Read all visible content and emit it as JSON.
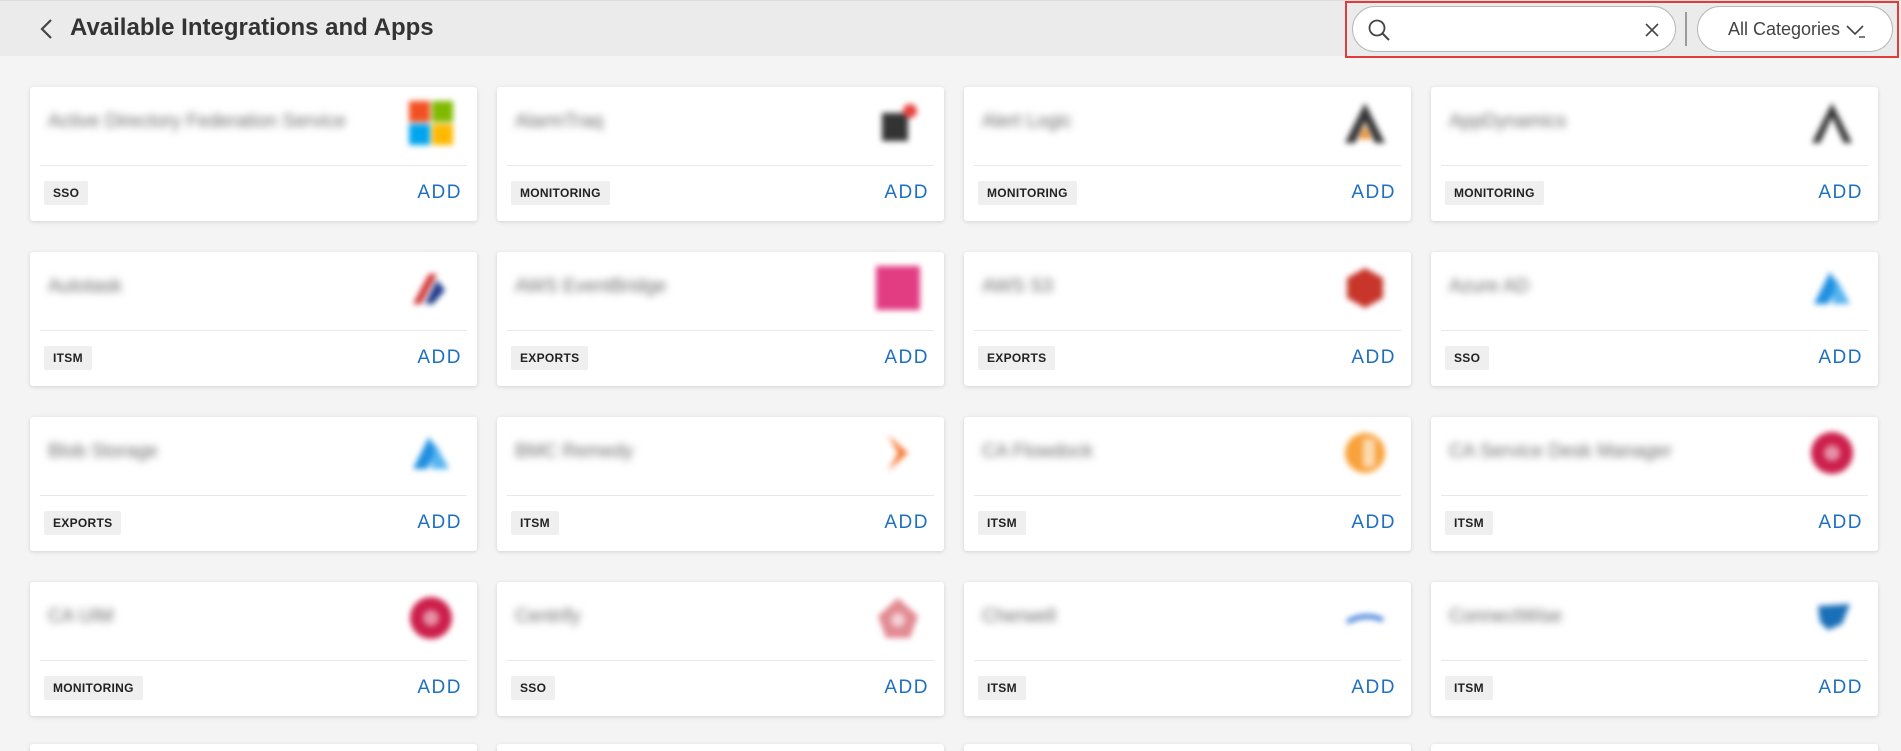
{
  "header": {
    "title": "Available Integrations and Apps",
    "search_value": "",
    "category_label": "All Categories"
  },
  "colors": {
    "accent": "#1d6fc1",
    "highlight": "#e03c3c"
  },
  "cards": [
    {
      "name": "Active Directory Federation Service",
      "tag": "SSO",
      "action": "ADD",
      "logo": "microsoft-logo-icon"
    },
    {
      "name": "AlarmTraq",
      "tag": "MONITORING",
      "action": "ADD",
      "logo": "alarm-logo-icon"
    },
    {
      "name": "Alert Logic",
      "tag": "MONITORING",
      "action": "ADD",
      "logo": "alertlogic-logo-icon"
    },
    {
      "name": "AppDynamics",
      "tag": "MONITORING",
      "action": "ADD",
      "logo": "appdynamics-logo-icon"
    },
    {
      "name": "Autotask",
      "tag": "ITSM",
      "action": "ADD",
      "logo": "autotask-logo-icon"
    },
    {
      "name": "AWS EventBridge",
      "tag": "EXPORTS",
      "action": "ADD",
      "logo": "eventbridge-logo-icon"
    },
    {
      "name": "AWS S3",
      "tag": "EXPORTS",
      "action": "ADD",
      "logo": "s3-logo-icon"
    },
    {
      "name": "Azure AD",
      "tag": "SSO",
      "action": "ADD",
      "logo": "azure-logo-icon"
    },
    {
      "name": "Blob Storage",
      "tag": "EXPORTS",
      "action": "ADD",
      "logo": "azure-logo-icon"
    },
    {
      "name": "BMC Remedy",
      "tag": "ITSM",
      "action": "ADD",
      "logo": "bmc-logo-icon"
    },
    {
      "name": "CA Flowdock",
      "tag": "ITSM",
      "action": "ADD",
      "logo": "flowdock-logo-icon"
    },
    {
      "name": "CA Service Desk Manager",
      "tag": "ITSM",
      "action": "ADD",
      "logo": "ca-logo-icon"
    },
    {
      "name": "CA UIM",
      "tag": "MONITORING",
      "action": "ADD",
      "logo": "ca-logo-icon"
    },
    {
      "name": "Centrify",
      "tag": "SSO",
      "action": "ADD",
      "logo": "centrify-logo-icon"
    },
    {
      "name": "Cherwell",
      "tag": "ITSM",
      "action": "ADD",
      "logo": "cherwell-logo-icon"
    },
    {
      "name": "ConnectWise",
      "tag": "ITSM",
      "action": "ADD",
      "logo": "connectwise-logo-icon"
    }
  ]
}
